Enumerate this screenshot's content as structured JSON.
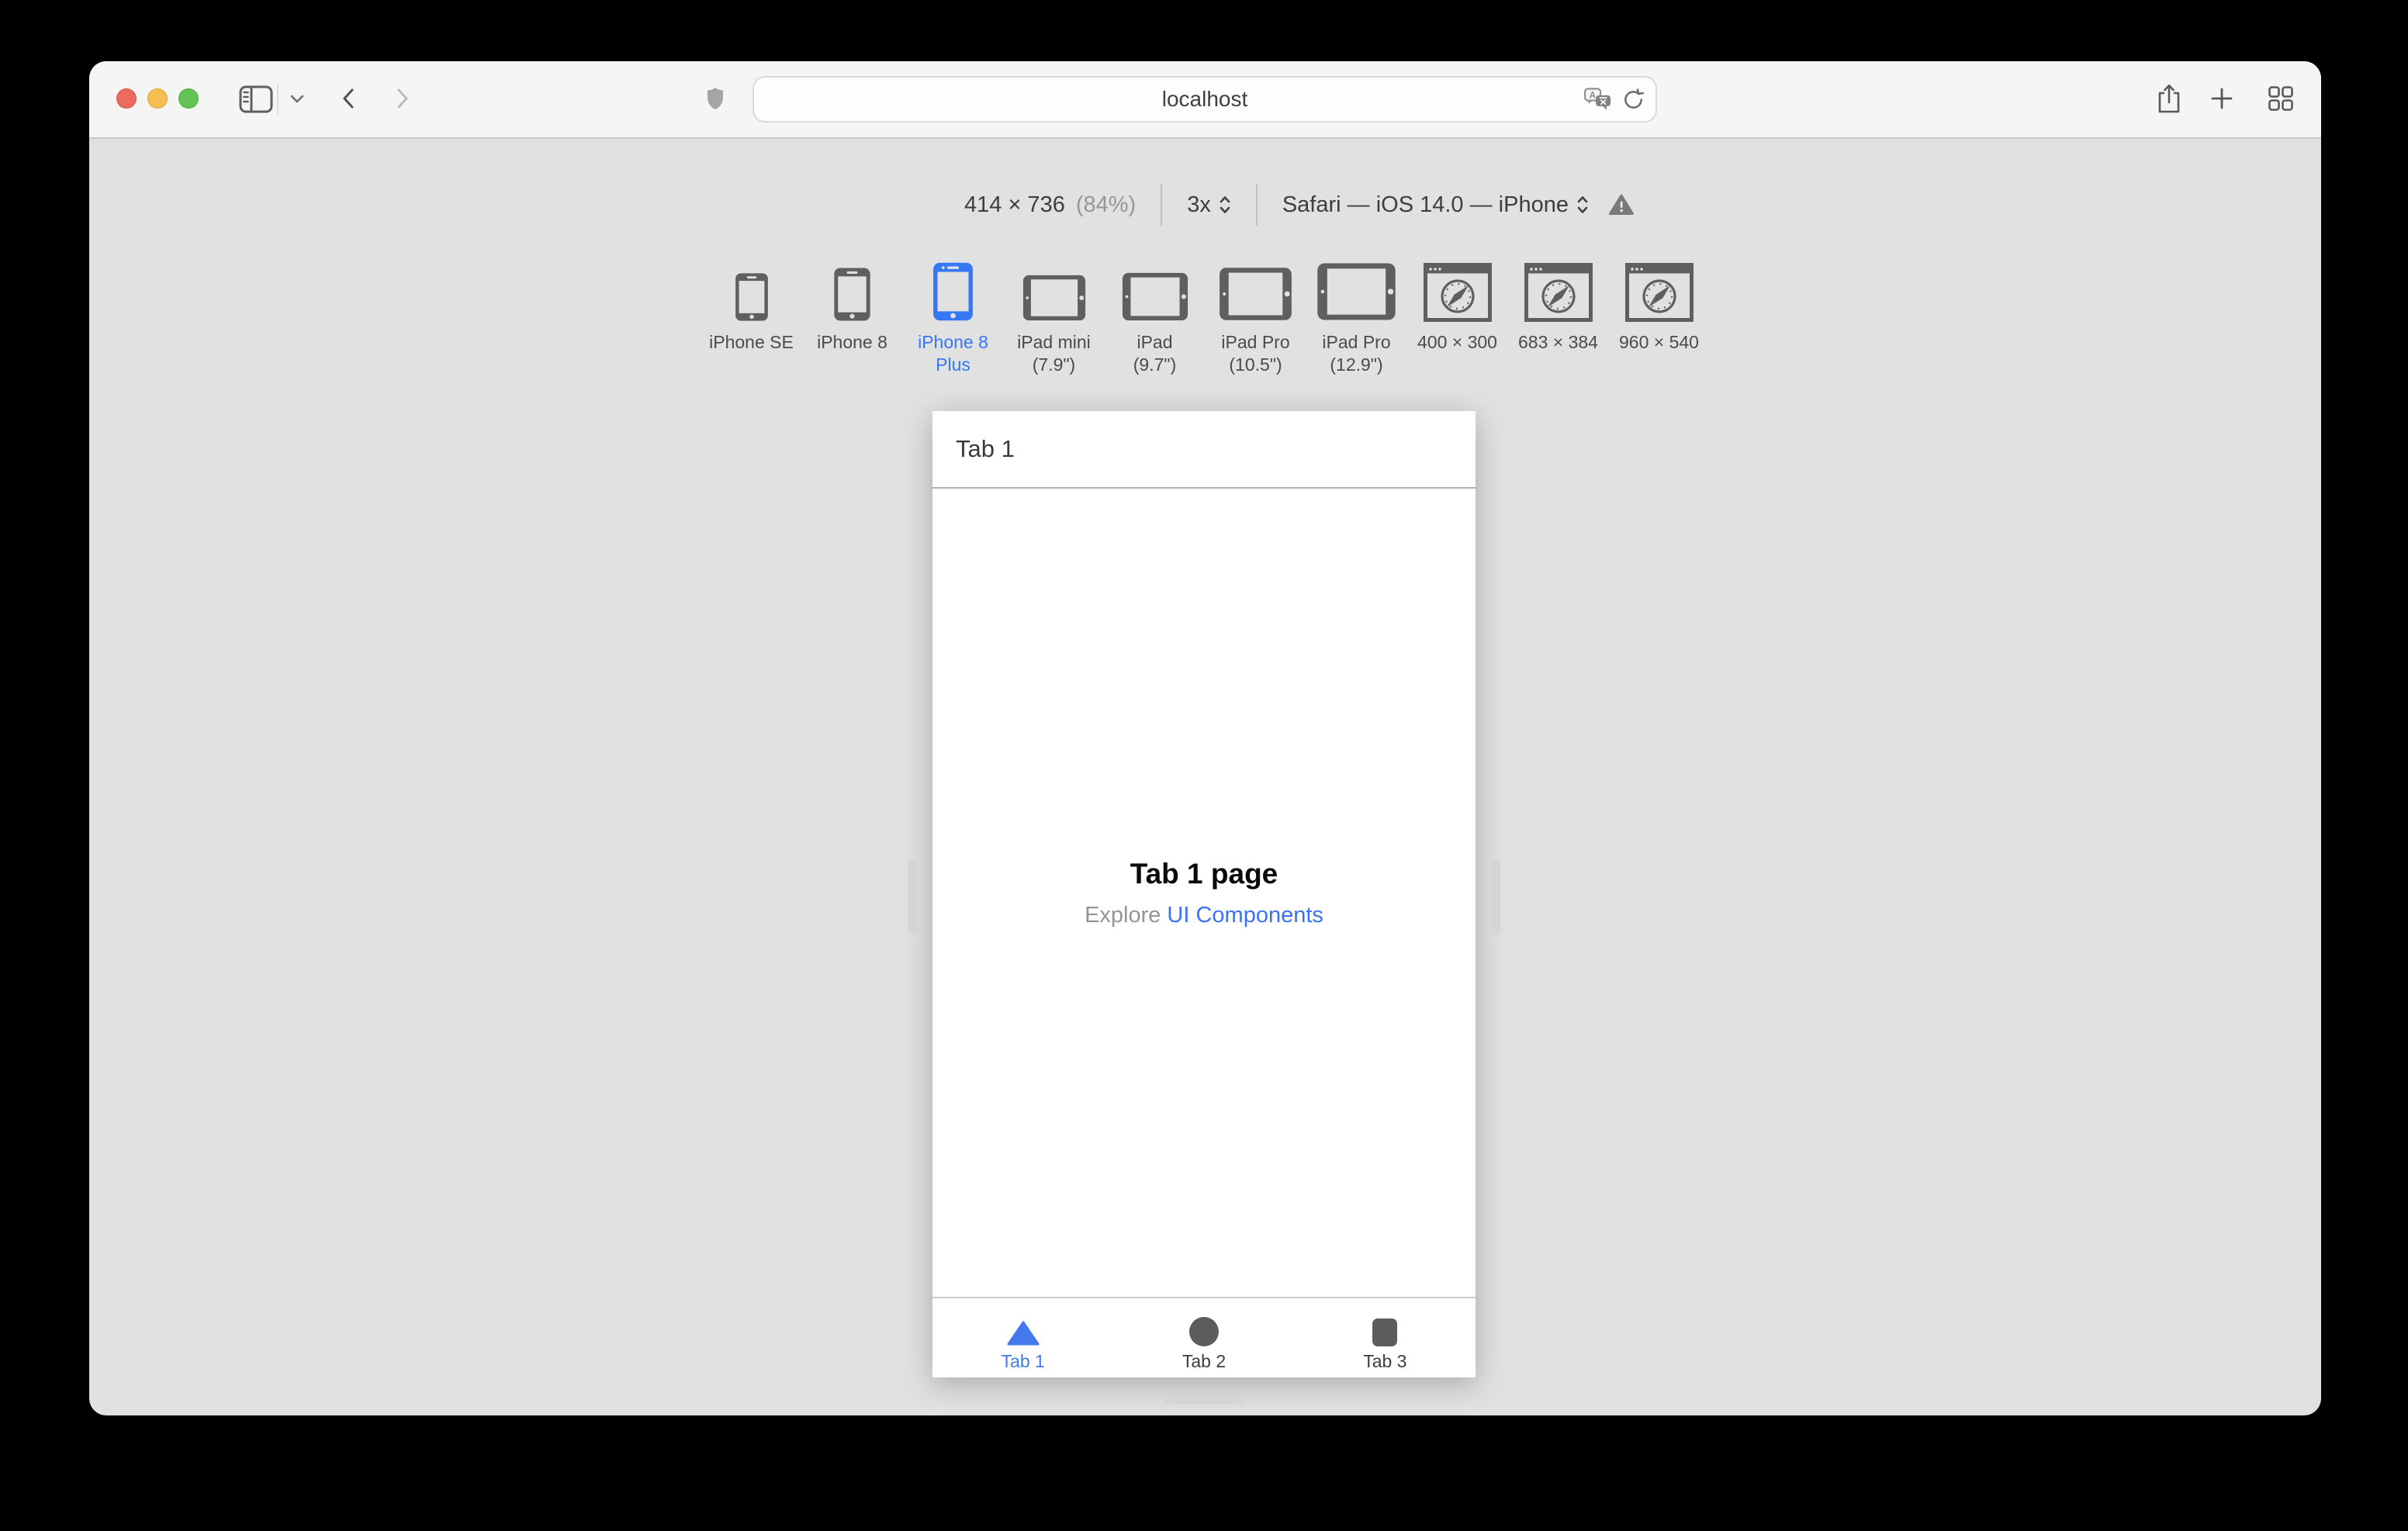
{
  "browser": {
    "url": "localhost"
  },
  "responsive_bar": {
    "size": "414 × 736",
    "zoom_percent": "(84%)",
    "pixel_ratio": "3x",
    "user_agent": "Safari — iOS 14.0 — iPhone"
  },
  "devices": [
    {
      "label": "iPhone SE",
      "selected": false
    },
    {
      "label": "iPhone 8",
      "selected": false
    },
    {
      "label": "iPhone 8\nPlus",
      "selected": true
    },
    {
      "label": "iPad mini\n(7.9\")",
      "selected": false
    },
    {
      "label": "iPad\n(9.7\")",
      "selected": false
    },
    {
      "label": "iPad Pro\n(10.5\")",
      "selected": false
    },
    {
      "label": "iPad Pro\n(12.9\")",
      "selected": false
    },
    {
      "label": "400 × 300",
      "selected": false
    },
    {
      "label": "683 × 384",
      "selected": false
    },
    {
      "label": "960 × 540",
      "selected": false
    }
  ],
  "viewport": {
    "nav_title": "Tab 1",
    "page_title": "Tab 1 page",
    "explore_prefix": "Explore",
    "explore_link": "UI Components",
    "tabs": [
      {
        "label": "Tab 1",
        "active": true
      },
      {
        "label": "Tab 2",
        "active": false
      },
      {
        "label": "Tab 3",
        "active": false
      }
    ]
  },
  "colors": {
    "accent_blue": "#3677f5",
    "link_blue": "#3b72f2",
    "traffic_red": "#ec6a5e",
    "traffic_yellow": "#f5bf4f",
    "traffic_green": "#61c454"
  }
}
